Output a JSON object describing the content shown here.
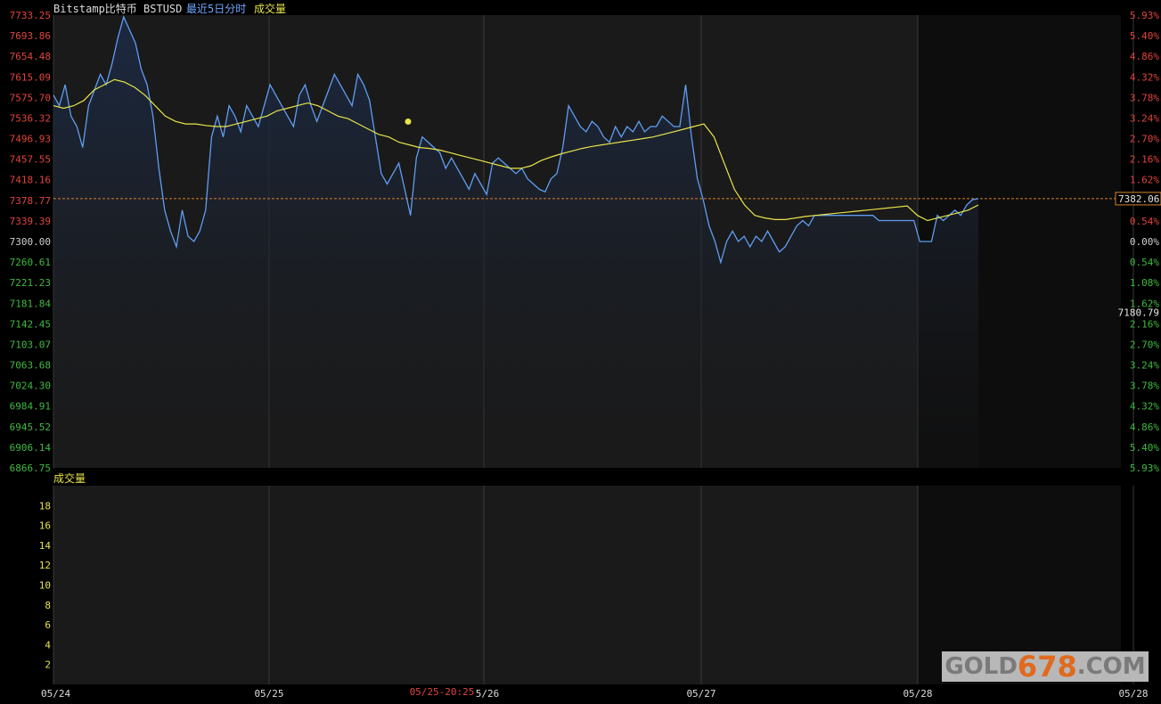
{
  "header": {
    "symbol": "Bitstamp比特币 BSTUSD",
    "period": "最近5日分时",
    "indicator": "成交量"
  },
  "volume_panel": {
    "title": "成交量"
  },
  "watermark": {
    "part_a": "GOLD",
    "part_b": "678",
    "part_c": ".COM"
  },
  "colors": {
    "price_line": "#5f9df2",
    "avg_line": "#e7e44a",
    "up_text": "#e0443c",
    "down_text": "#3fbb3f",
    "neutral_text": "#cfcfcf",
    "ref_line": "#d9812a",
    "volume_tick": "#e7e44a"
  },
  "chart_data": [
    {
      "type": "line",
      "title": "",
      "series": [
        {
          "name": "",
          "role": "price",
          "values": [
            7580,
            7560,
            7600,
            7540,
            7520,
            7480,
            7560,
            7590,
            7620,
            7600,
            7640,
            7690,
            7730,
            7705,
            7680,
            7630,
            7600,
            7540,
            7440,
            7360,
            7320,
            7290,
            7360,
            7310,
            7300,
            7320,
            7360,
            7500,
            7540,
            7500,
            7560,
            7540,
            7510,
            7560,
            7540,
            7520,
            7560,
            7600,
            7580,
            7560,
            7540,
            7520,
            7580,
            7600,
            7560,
            7530,
            7560,
            7590,
            7620,
            7600,
            7580,
            7560,
            7620,
            7600,
            7570,
            7500,
            7430,
            7410,
            7430,
            7450,
            7400,
            7350,
            7460,
            7500,
            7490,
            7480,
            7470,
            7440,
            7460,
            7440,
            7420,
            7400,
            7430,
            7410,
            7390,
            7450,
            7460,
            7450,
            7440,
            7430,
            7440,
            7420,
            7410,
            7400,
            7395,
            7420,
            7430,
            7480,
            7560,
            7540,
            7520,
            7510,
            7530,
            7520,
            7500,
            7490,
            7520,
            7500,
            7520,
            7510,
            7530,
            7510,
            7520,
            7520,
            7540,
            7530,
            7520,
            7520,
            7600,
            7500,
            7420,
            7380,
            7330,
            7300,
            7260,
            7300,
            7320,
            7300,
            7310,
            7290,
            7310,
            7300,
            7320,
            7300,
            7280,
            7290,
            7310,
            7330,
            7340,
            7330,
            7350,
            7350,
            7350,
            7350,
            7350,
            7350,
            7350,
            7350,
            7350,
            7350,
            7350,
            7340,
            7340,
            7340,
            7340,
            7340,
            7340,
            7340,
            7300,
            7300,
            7300,
            7350,
            7340,
            7350,
            7360,
            7350,
            7370,
            7380,
            7382
          ],
          "avg_values": [
            7560,
            7555,
            7560,
            7570,
            7590,
            7600,
            7610,
            7605,
            7595,
            7580,
            7560,
            7540,
            7530,
            7525,
            7525,
            7522,
            7520,
            7520,
            7525,
            7530,
            7535,
            7540,
            7550,
            7555,
            7560,
            7565,
            7560,
            7550,
            7540,
            7535,
            7525,
            7515,
            7505,
            7500,
            7490,
            7485,
            7480,
            7478,
            7475,
            7470,
            7465,
            7460,
            7455,
            7450,
            7445,
            7440,
            7440,
            7445,
            7455,
            7462,
            7468,
            7473,
            7478,
            7482,
            7485,
            7488,
            7491,
            7494,
            7497,
            7500,
            7505,
            7510,
            7515,
            7520,
            7525,
            7500,
            7450,
            7400,
            7370,
            7350,
            7345,
            7342,
            7342,
            7345,
            7348,
            7350,
            7352,
            7354,
            7356,
            7358,
            7360,
            7362,
            7364,
            7366,
            7368,
            7350,
            7340,
            7345,
            7350,
            7355,
            7360,
            7370
          ]
        }
      ],
      "x_ticks": [
        "05/24",
        "05/25",
        "5/26",
        "05/27",
        "05/28",
        "05/28"
      ],
      "cursor_time_label": "05/25-20:25",
      "y_ticks": [
        "7733.25",
        "7693.86",
        "7654.48",
        "7615.09",
        "7575.70",
        "7536.32",
        "7496.93",
        "7457.55",
        "7418.16",
        "7378.77",
        "7339.39",
        "7300.00",
        "7260.61",
        "7221.23",
        "7181.84",
        "7142.45",
        "7103.07",
        "7063.68",
        "7024.30",
        "6984.91",
        "6945.52",
        "6906.14",
        "6866.75"
      ],
      "pct_ticks": [
        "5.93%",
        "5.40%",
        "4.86%",
        "4.32%",
        "3.78%",
        "3.24%",
        "2.70%",
        "2.16%",
        "1.62%",
        "1.08%",
        "0.54%",
        "0.00%",
        "0.54%",
        "1.08%",
        "1.62%",
        "2.16%",
        "2.70%",
        "3.24%",
        "3.78%",
        "4.32%",
        "4.86%",
        "5.40%",
        "5.93%"
      ],
      "ylim": [
        6866.75,
        7733.25
      ],
      "reference_price": 7300.0,
      "current_price_label": "7382.06",
      "cursor_price_label": "7180.79",
      "grid": false,
      "legend": "none"
    },
    {
      "type": "bar",
      "title": "成交量",
      "y_ticks": [
        "18",
        "16",
        "14",
        "12",
        "10",
        "8",
        "6",
        "4",
        "2"
      ],
      "ylim": [
        0,
        20
      ],
      "values": []
    }
  ]
}
